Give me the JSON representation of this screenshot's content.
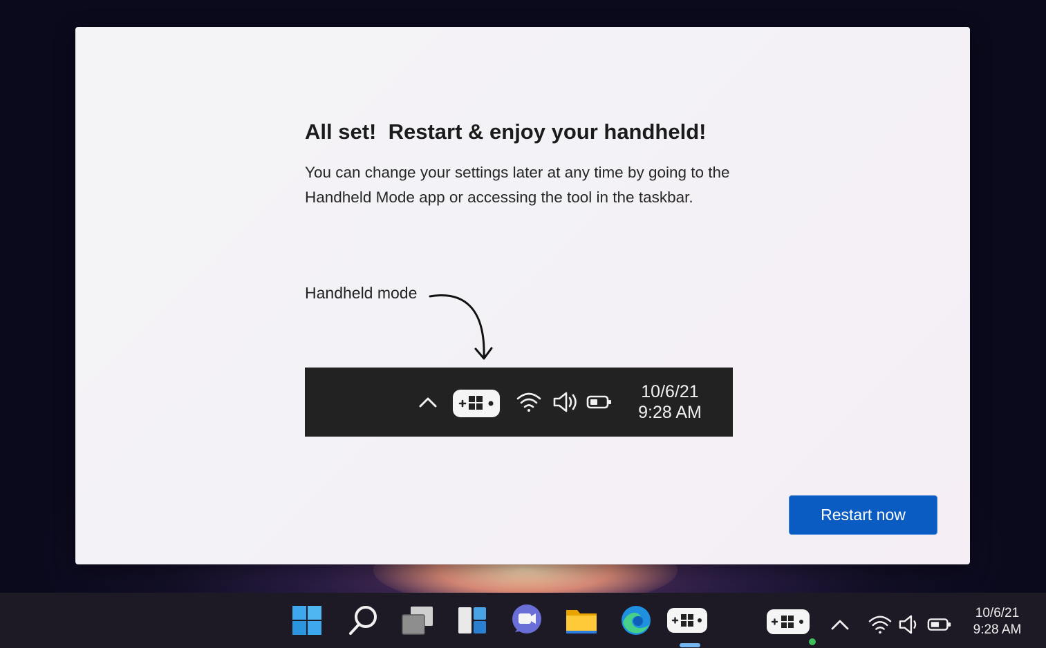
{
  "dialog": {
    "title": "All set!  Restart & enjoy your handheld!",
    "body": "You can change your settings later at any time by going to the Handheld Mode app or accessing the tool in the taskbar.",
    "callout_label": "Handheld mode",
    "demo_taskbar": {
      "date": "10/6/21",
      "time": "9:28 AM",
      "icons": [
        "chevron-up-icon",
        "handheld-mode-icon",
        "wifi-icon",
        "volume-icon",
        "battery-icon"
      ]
    },
    "restart_button": "Restart now"
  },
  "taskbar": {
    "apps": [
      "windows-start-icon",
      "search-icon",
      "task-view-icon",
      "widgets-icon",
      "teams-chat-icon",
      "file-explorer-icon",
      "edge-icon",
      "handheld-mode-app-icon"
    ],
    "tray_icons": [
      "handheld-mode-icon",
      "chevron-up-icon",
      "wifi-icon",
      "volume-icon",
      "battery-icon"
    ],
    "date": "10/6/21",
    "time": "9:28 AM"
  },
  "colors": {
    "accent": "#0a5cc2",
    "taskbar_demo": "#222222",
    "status_dot": "#3fbf5a"
  }
}
